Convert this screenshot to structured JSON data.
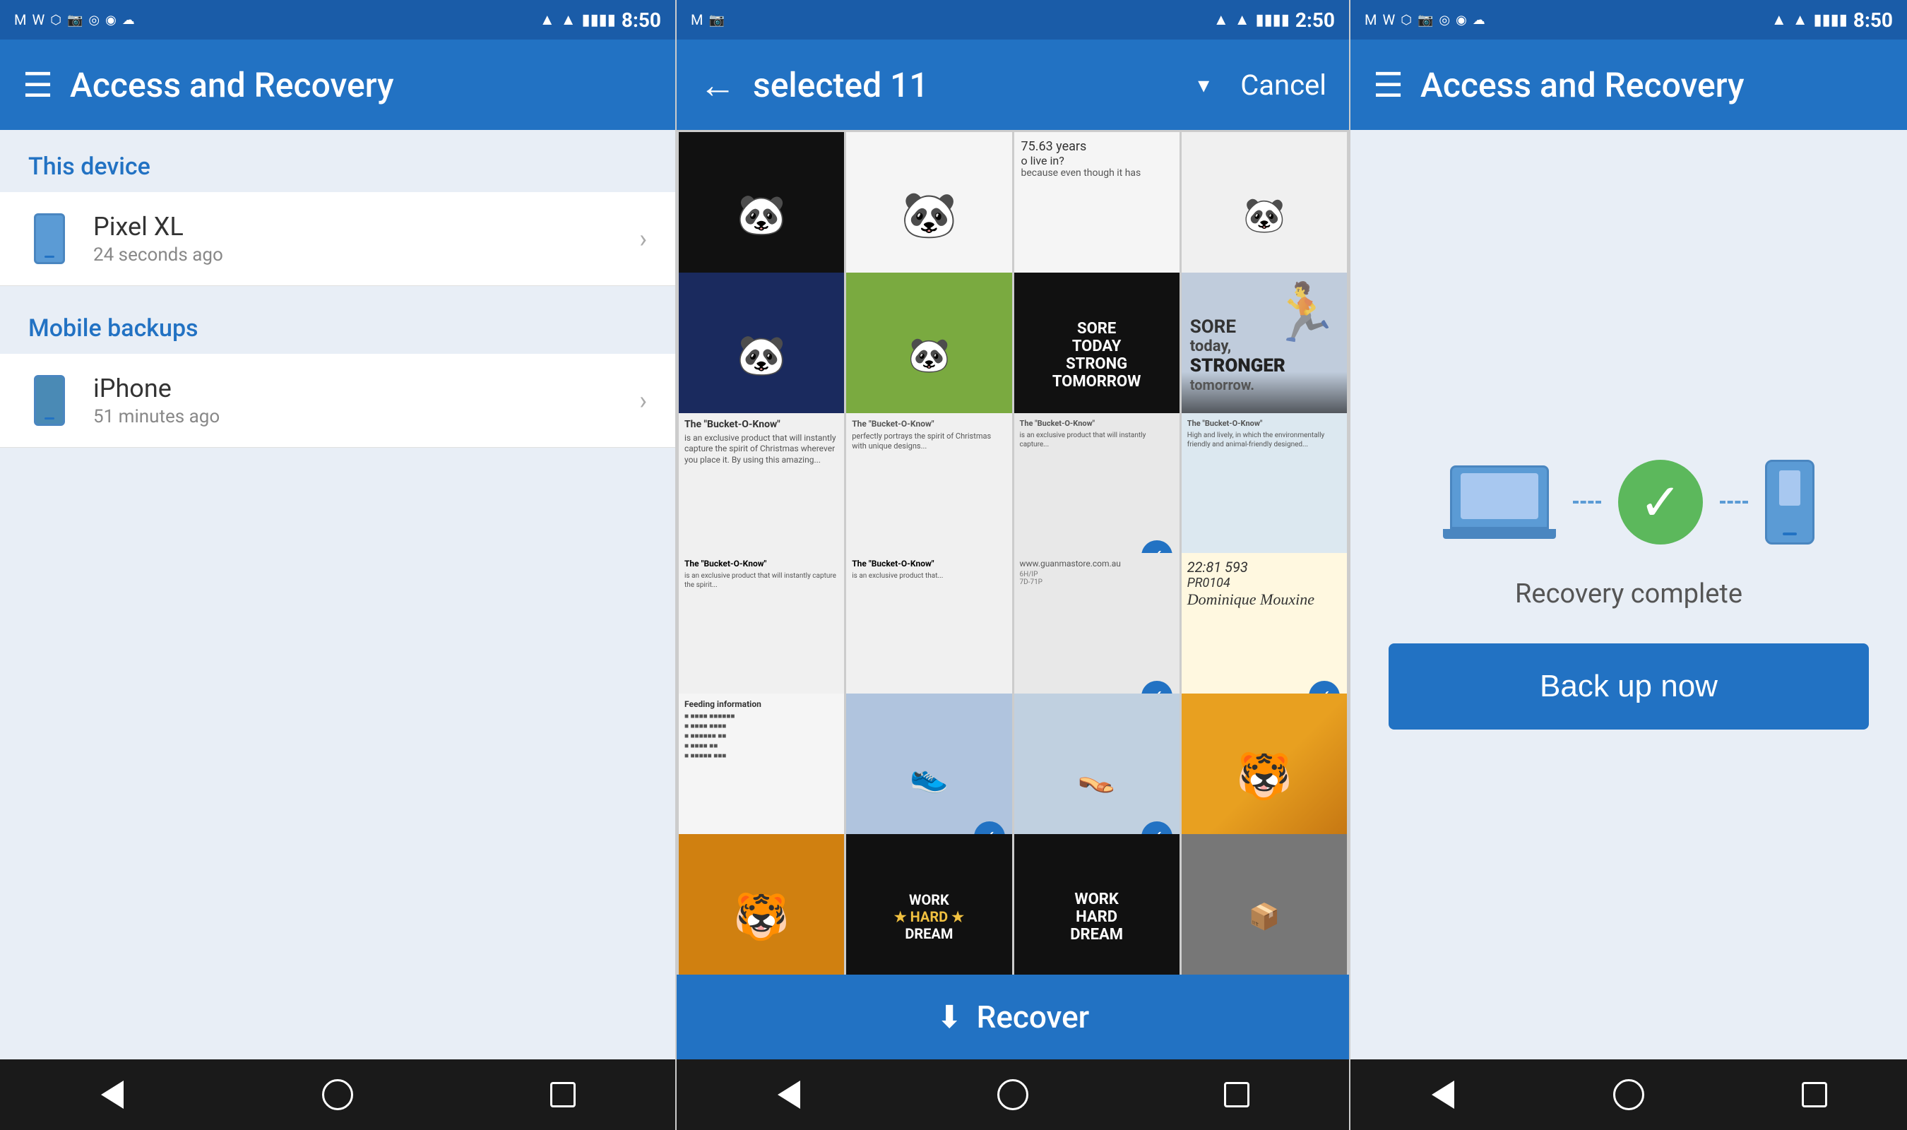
{
  "panel1": {
    "statusBar": {
      "leftIcons": [
        "M",
        "W",
        "circle",
        "camera",
        "instagram",
        "instagram2",
        "cloud"
      ],
      "signal": "▲▲",
      "battery": "🔋",
      "time": "8:50"
    },
    "appBar": {
      "menuLabel": "☰",
      "title": "Access and Recovery"
    },
    "sectionThis": "This device",
    "devicePixel": {
      "name": "Pixel XL",
      "time": "24 seconds ago"
    },
    "sectionMobile": "Mobile backups",
    "deviceIphone": {
      "name": "iPhone",
      "time": "51 minutes ago"
    }
  },
  "panel2": {
    "statusBar": {
      "leftIcons": [
        "M",
        "camera"
      ],
      "signal": "▲▲",
      "battery": "🔋",
      "time": "2:50"
    },
    "appBar": {
      "backLabel": "←",
      "selectedLabel": "selected 11",
      "dropdownArrow": "▾",
      "cancelLabel": "Cancel"
    },
    "photos": [
      {
        "id": 1,
        "type": "panda-black",
        "checked": false
      },
      {
        "id": 2,
        "type": "panda-face",
        "checked": false
      },
      {
        "id": 3,
        "type": "panda-face2",
        "checked": false
      },
      {
        "id": 4,
        "type": "panda-text",
        "checked": false
      },
      {
        "id": 5,
        "type": "blue-panda",
        "checked": false
      },
      {
        "id": 6,
        "type": "bamboo-panda",
        "checked": false
      },
      {
        "id": 7,
        "type": "sore-dark",
        "checked": false
      },
      {
        "id": 8,
        "type": "sore-light",
        "checked": false
      },
      {
        "id": 9,
        "type": "doc1",
        "checked": false
      },
      {
        "id": 10,
        "type": "doc2",
        "checked": false
      },
      {
        "id": 11,
        "type": "doc3",
        "checked": true
      },
      {
        "id": 12,
        "type": "doc4",
        "checked": false
      },
      {
        "id": 13,
        "type": "doc5",
        "checked": false
      },
      {
        "id": 14,
        "type": "doc6",
        "checked": false
      },
      {
        "id": 15,
        "type": "doc7",
        "checked": true
      },
      {
        "id": 16,
        "type": "handwriting",
        "checked": true
      },
      {
        "id": 17,
        "type": "feeding",
        "checked": false
      },
      {
        "id": 18,
        "type": "sandal1",
        "checked": true
      },
      {
        "id": 19,
        "type": "sandal2",
        "checked": true
      },
      {
        "id": 20,
        "type": "tiger1",
        "checked": false
      },
      {
        "id": 21,
        "type": "tiger2",
        "checked": false
      },
      {
        "id": 22,
        "type": "work1",
        "checked": false
      },
      {
        "id": 23,
        "type": "work2",
        "checked": false
      },
      {
        "id": 24,
        "type": "red-item",
        "checked": false
      }
    ],
    "recoverBar": {
      "icon": "⬇",
      "label": "Recover"
    }
  },
  "panel3": {
    "statusBar": {
      "leftIcons": [
        "M",
        "W",
        "circle",
        "camera",
        "instagram",
        "instagram2",
        "cloud"
      ],
      "signal": "▲▲",
      "battery": "🔋",
      "time": "8:50"
    },
    "appBar": {
      "menuLabel": "☰",
      "title": "Access and Recovery"
    },
    "recoveryStatus": "Recovery complete",
    "backupBtn": "Back up now"
  },
  "nav": {
    "back": "◁",
    "home": "○",
    "recent": "□"
  }
}
